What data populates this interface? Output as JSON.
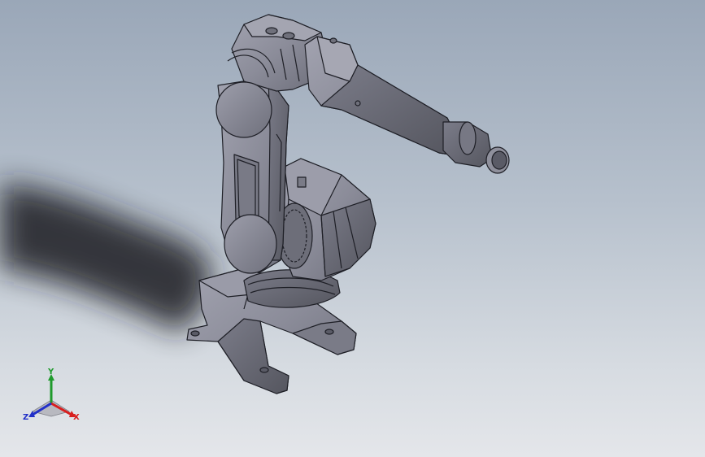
{
  "viewport": {
    "background_top": "#9aa7b8",
    "background_bottom": "#e4e6ea"
  },
  "model": {
    "body_color": "#8b8c99",
    "edge_color": "#1e1f26",
    "shadow_color": "#1b1d22"
  },
  "triad": {
    "x_label": "X",
    "y_label": "Y",
    "z_label": "Z",
    "x_color": "#d81e1e",
    "y_color": "#1f9a2c",
    "z_color": "#2230c8"
  }
}
